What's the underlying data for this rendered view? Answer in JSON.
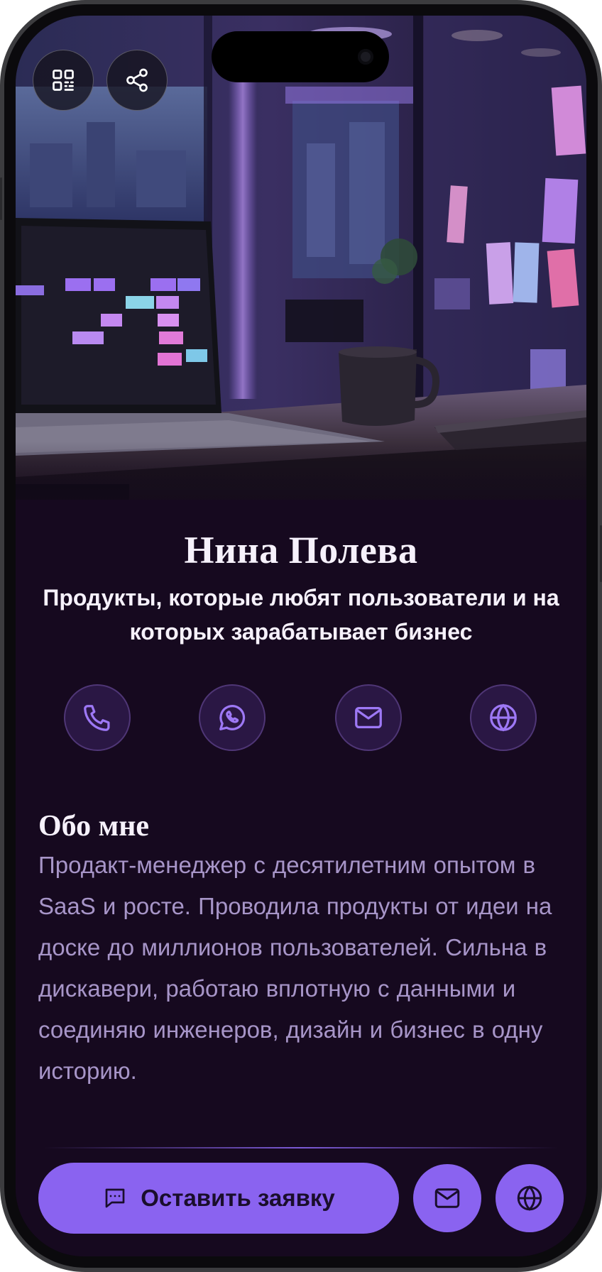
{
  "profile": {
    "name": "Нина Полева",
    "tagline": "Продукты, которые любят пользователи и на которых зарабатывает бизнес"
  },
  "toolbar": {
    "icons": [
      "qr-code-icon",
      "share-icon"
    ]
  },
  "contacts": [
    {
      "icon": "phone-icon"
    },
    {
      "icon": "whatsapp-icon"
    },
    {
      "icon": "mail-icon"
    },
    {
      "icon": "globe-icon"
    }
  ],
  "about": {
    "title": "Обо мне",
    "text": "Продакт-менеджер с десятилетним опытом в SaaS и росте. Проводила продукты от идеи на доске до миллионов пользователей. Сильна в дискавери, работаю вплотную с данными и соединяю инженеров, дизайн и бизнес в одну историю."
  },
  "footer": {
    "cta_label": "Оставить заявку",
    "cta_icon": "chat-icon",
    "buttons": [
      "mail-icon",
      "globe-icon"
    ]
  },
  "colors": {
    "background": "#16091f",
    "accent": "#8a63f0",
    "contact_button_bg": "#2a1744",
    "text_primary": "#f6f1fb",
    "text_muted": "#a795c8"
  }
}
